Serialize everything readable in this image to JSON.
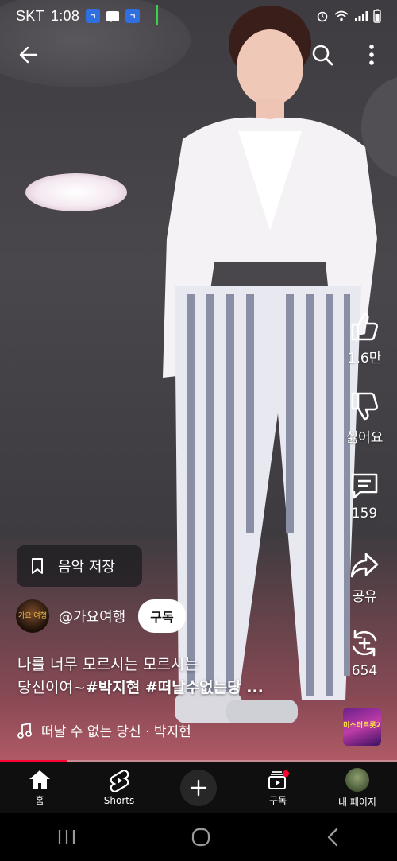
{
  "status_bar": {
    "carrier": "SKT",
    "time": "1:08",
    "badge": "ㄱ"
  },
  "player": {
    "like_count": "1.6만",
    "dislike_label": "싫어요",
    "comment_count": "159",
    "share_label": "공유",
    "remix_count": "654",
    "save_music_label": "음악 저장",
    "channel_handle": "@가요여행",
    "subscribe_label": "구독",
    "description_line1": "나를 너무 모르시는 모르시는",
    "description_line2_plain": "당신이여~",
    "description_line2_tags": "#박지현 #떠날수없는당 ...",
    "music_track": "떠날 수 없는 당신 · 박지현",
    "avatar_text": "가요 여행",
    "album_text": "미스터트롯2",
    "progress": 0.17
  },
  "bottom_nav": {
    "home": "홈",
    "shorts": "Shorts",
    "subscriptions": "구독",
    "my_page": "내 페이지"
  },
  "colors": {
    "accent": "#ff0033",
    "nav_bg": "#0f0f0f",
    "subscribe_bg": "#ffffff"
  }
}
